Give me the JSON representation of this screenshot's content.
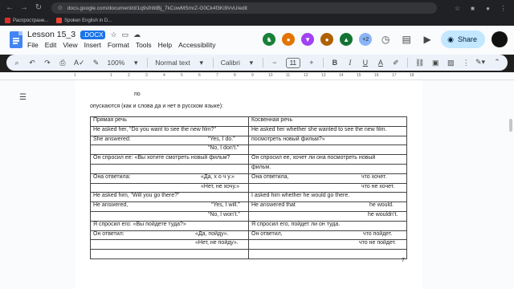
{
  "browser": {
    "url": "docs.google.com/document/d/1q9sfnfdBj_7kCowMSmrZ-G0Ck4f3Ki9VvU/edit",
    "bookmarks": [
      {
        "label": "Распространи...",
        "color": "#d93025"
      },
      {
        "label": "Spoken English in D...",
        "color": "#ea4335"
      }
    ]
  },
  "docs": {
    "title": "Lesson 15_3",
    "file_badge": ".DOCX",
    "menu": [
      "File",
      "Edit",
      "View",
      "Insert",
      "Format",
      "Tools",
      "Help",
      "Accessibility"
    ],
    "collaborators_extra": "+2",
    "share_label": "Share",
    "accent_color": "#1a73e8"
  },
  "toolbar": {
    "zoom": "100%",
    "style": "Normal text",
    "font": "Calibri",
    "font_size": "11"
  },
  "ruler": {
    "numbers": [
      "1",
      "1",
      "2",
      "3",
      "4",
      "5",
      "6",
      "7",
      "8",
      "9",
      "10",
      "11",
      "12",
      "13",
      "14",
      "15",
      "16",
      "17",
      "18"
    ]
  },
  "doc": {
    "stray_word": "по",
    "intro": "опускаются (как и слова да и нет в русском языке):",
    "page_number": "7",
    "rows": [
      {
        "left": "Прямая речь",
        "left_right": "",
        "right": "Косвенная речь",
        "right_right": ""
      },
      {
        "left": "He asked her, “Do you want to see the new film?”",
        "left_right": "",
        "right": "He asked her whether she wanted to see the new film.",
        "right_right": ""
      },
      {
        "left": "She answered:",
        "left_right": "“Yes, I do.”",
        "right": "посмотреть новый фильм?»",
        "right_right": ""
      },
      {
        "left": "",
        "left_right": "“No, I don’t.”",
        "right": "",
        "right_right": ""
      },
      {
        "left": "Он спросил ее: «Вы хотите смотреть новый фильм?",
        "left_right": "",
        "right": "Он спросил ее, хочет ли она посмотреть новый",
        "right_right": ""
      },
      {
        "left": "",
        "left_right": "",
        "right": "фильм.",
        "right_right": ""
      },
      {
        "left": "Она ответила:",
        "left_right": "«Да,  х о ч у.»",
        "right": "Она ответила,",
        "right_right": "что  хочет."
      },
      {
        "left": "",
        "left_right": "«Нет, не хочу.»",
        "right": "",
        "right_right": "что не хочет."
      },
      {
        "left": "He asked him, “Will you go there?”",
        "left_right": "",
        "right": "I asked him whether he would go there.",
        "right_right": ""
      },
      {
        "left": "He answered,",
        "left_right": "“Yes, I will.”",
        "right": "He answered that",
        "right_right": "he would."
      },
      {
        "left": "",
        "left_right": "“No, I won’t.”",
        "right": "",
        "right_right": "he wouldn’t."
      },
      {
        "left": "Я спросил его: «Вы пойдете туда?»",
        "left_right": "",
        "right": "Я спросил его, пойдет ли он туда.",
        "right_right": ""
      },
      {
        "left": "Он ответил:",
        "left_right": "«Да, пойду».",
        "right": "Он ответил,",
        "right_right": "что пойдет."
      },
      {
        "left": "",
        "left_right": "«Нет, не пойду».",
        "right": "",
        "right_right": "что не пойдет."
      },
      {
        "left": "",
        "left_right": "",
        "right": "",
        "right_right": ""
      }
    ]
  }
}
